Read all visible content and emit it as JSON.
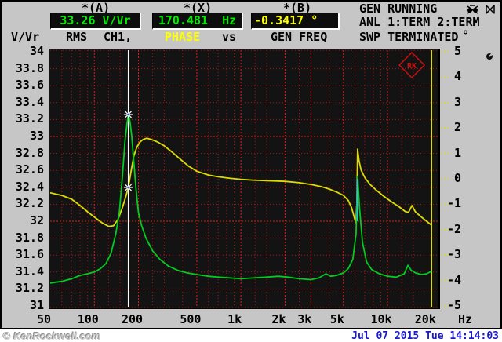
{
  "header": {
    "readout_a": {
      "label": "*(A)",
      "value": "33.26 V/Vr"
    },
    "readout_x": {
      "label": "*(X)",
      "value": "170.481  Hz"
    },
    "readout_b": {
      "label": "*(B)",
      "value": "-0.3417 °"
    },
    "status": {
      "gen": "GEN RUNNING",
      "anl": "ANL 1:TERM 2:TERM",
      "swp": "SWP TERMINATED"
    },
    "icons": [
      "alarm-muted-icon",
      "speaker-muted-icon"
    ]
  },
  "trace_row": {
    "unit_left": "V/Vr",
    "meas": "RMS",
    "channel": "CH1,",
    "phase": "PHASE",
    "vs": "vs",
    "xsource": "GEN FREQ",
    "unit_right_deg": "°",
    "unit_right_hz": "Hz"
  },
  "footer": {
    "watermark": "© KenRockwell.com",
    "datetime": "Jul 07 2015 Tue 14:14:03"
  },
  "colors": {
    "panel": "#c6c6c6",
    "plot_bg": "#131313",
    "grid_minor": "#b81111",
    "grid_major": "#e31818",
    "level_trace": "#00cc22",
    "phase_trace": "#dcdc00",
    "readout_green": "#00ee00",
    "readout_yellow": "#ffff00",
    "cursor": "#ffffff",
    "logo_red": "#cc1111",
    "datetime_blue": "#1a1acc"
  },
  "chart_data": {
    "type": "line",
    "title": "RMS CH1, PHASE vs GEN FREQ",
    "x_axis": {
      "scale": "log",
      "min": 50,
      "max": 22000,
      "unit": "Hz",
      "ticks": [
        [
          50,
          "50"
        ],
        [
          100,
          "100"
        ],
        [
          200,
          "200"
        ],
        [
          500,
          "500"
        ],
        [
          1000,
          "1k"
        ],
        [
          2000,
          "2k"
        ],
        [
          3000,
          "3k"
        ],
        [
          5000,
          "5k"
        ],
        [
          10000,
          "10k"
        ],
        [
          20000,
          "20k"
        ]
      ],
      "minor": [
        60,
        70,
        80,
        90,
        125,
        150,
        250,
        300,
        400,
        600,
        700,
        800,
        900,
        1250,
        1500,
        2500,
        4000,
        6000,
        7000,
        8000,
        9000,
        12500,
        15000
      ]
    },
    "y_left": {
      "label": "V/Vr",
      "min": 31,
      "max": 34,
      "step": 0.2,
      "major": [
        33,
        32
      ]
    },
    "y_right": {
      "label": "°",
      "min": -5,
      "max": 5,
      "step": 1
    },
    "legend_position": "top-row",
    "grid": "red-dotted",
    "cursor": {
      "freq": 170.481,
      "a_value": 33.26,
      "b_deg": -0.3417
    },
    "phase_wrap_freq": 20000,
    "overlap_segment": {
      "freq": 6230,
      "from_v": 32.0,
      "to_v": 32.5
    },
    "plot_logo": "RK",
    "series": [
      {
        "name": "PHASE",
        "axis": "right",
        "color": "#dcdc00",
        "points": [
          [
            50,
            -0.55
          ],
          [
            60,
            -0.65
          ],
          [
            70,
            -0.8
          ],
          [
            80,
            -1.05
          ],
          [
            90,
            -1.3
          ],
          [
            100,
            -1.5
          ],
          [
            112,
            -1.72
          ],
          [
            125,
            -1.87
          ],
          [
            135,
            -1.85
          ],
          [
            145,
            -1.6
          ],
          [
            155,
            -1.15
          ],
          [
            163,
            -0.75
          ],
          [
            170.481,
            -0.3417
          ],
          [
            178,
            0.3
          ],
          [
            186,
            0.9
          ],
          [
            195,
            1.25
          ],
          [
            205,
            1.45
          ],
          [
            215,
            1.55
          ],
          [
            228,
            1.6
          ],
          [
            245,
            1.55
          ],
          [
            270,
            1.45
          ],
          [
            300,
            1.3
          ],
          [
            340,
            1.05
          ],
          [
            390,
            0.75
          ],
          [
            440,
            0.5
          ],
          [
            500,
            0.3
          ],
          [
            600,
            0.15
          ],
          [
            700,
            0.08
          ],
          [
            850,
            0.02
          ],
          [
            1000,
            -0.02
          ],
          [
            1200,
            -0.05
          ],
          [
            1500,
            -0.07
          ],
          [
            2000,
            -0.1
          ],
          [
            2500,
            -0.15
          ],
          [
            3000,
            -0.22
          ],
          [
            3500,
            -0.3
          ],
          [
            4000,
            -0.4
          ],
          [
            4500,
            -0.52
          ],
          [
            5000,
            -0.65
          ],
          [
            5400,
            -0.85
          ],
          [
            5700,
            -1.15
          ],
          [
            5950,
            -1.55
          ],
          [
            6080,
            -1.72
          ],
          [
            6180,
            -1.0
          ],
          [
            6250,
            1.17
          ],
          [
            6400,
            0.7
          ],
          [
            6600,
            0.35
          ],
          [
            7000,
            0.05
          ],
          [
            7600,
            -0.22
          ],
          [
            8400,
            -0.45
          ],
          [
            9400,
            -0.68
          ],
          [
            10500,
            -0.88
          ],
          [
            12000,
            -1.1
          ],
          [
            13200,
            -1.28
          ],
          [
            13900,
            -1.32
          ],
          [
            14700,
            -1.05
          ],
          [
            15500,
            -1.3
          ],
          [
            17000,
            -1.5
          ],
          [
            18500,
            -1.67
          ],
          [
            20000,
            -1.82
          ]
        ]
      },
      {
        "name": "RMS CH1",
        "axis": "left",
        "color": "#00cc22",
        "points": [
          [
            50,
            31.27
          ],
          [
            60,
            31.29
          ],
          [
            70,
            31.32
          ],
          [
            80,
            31.36
          ],
          [
            90,
            31.38
          ],
          [
            100,
            31.4
          ],
          [
            110,
            31.44
          ],
          [
            120,
            31.5
          ],
          [
            130,
            31.62
          ],
          [
            140,
            31.85
          ],
          [
            148,
            32.1
          ],
          [
            155,
            32.5
          ],
          [
            162,
            32.95
          ],
          [
            167,
            33.15
          ],
          [
            170.481,
            33.26
          ],
          [
            175,
            33.18
          ],
          [
            180,
            33.0
          ],
          [
            186,
            32.7
          ],
          [
            192,
            32.4
          ],
          [
            200,
            32.1
          ],
          [
            210,
            31.95
          ],
          [
            225,
            31.8
          ],
          [
            250,
            31.65
          ],
          [
            280,
            31.55
          ],
          [
            320,
            31.47
          ],
          [
            370,
            31.42
          ],
          [
            430,
            31.39
          ],
          [
            500,
            31.37
          ],
          [
            600,
            31.35
          ],
          [
            700,
            31.34
          ],
          [
            850,
            31.33
          ],
          [
            1000,
            31.32
          ],
          [
            1200,
            31.33
          ],
          [
            1500,
            31.34
          ],
          [
            1800,
            31.35
          ],
          [
            2100,
            31.34
          ],
          [
            2500,
            31.32
          ],
          [
            3000,
            31.31
          ],
          [
            3400,
            31.33
          ],
          [
            3800,
            31.38
          ],
          [
            4100,
            31.35
          ],
          [
            4500,
            31.36
          ],
          [
            5000,
            31.39
          ],
          [
            5400,
            31.44
          ],
          [
            5800,
            31.55
          ],
          [
            6100,
            31.85
          ],
          [
            6250,
            32.53
          ],
          [
            6450,
            32.15
          ],
          [
            6750,
            31.75
          ],
          [
            7200,
            31.52
          ],
          [
            7800,
            31.43
          ],
          [
            8800,
            31.38
          ],
          [
            10000,
            31.35
          ],
          [
            11500,
            31.34
          ],
          [
            13000,
            31.38
          ],
          [
            13800,
            31.48
          ],
          [
            14500,
            31.42
          ],
          [
            15500,
            31.39
          ],
          [
            17000,
            31.37
          ],
          [
            18500,
            31.38
          ],
          [
            20000,
            31.41
          ]
        ]
      }
    ]
  }
}
